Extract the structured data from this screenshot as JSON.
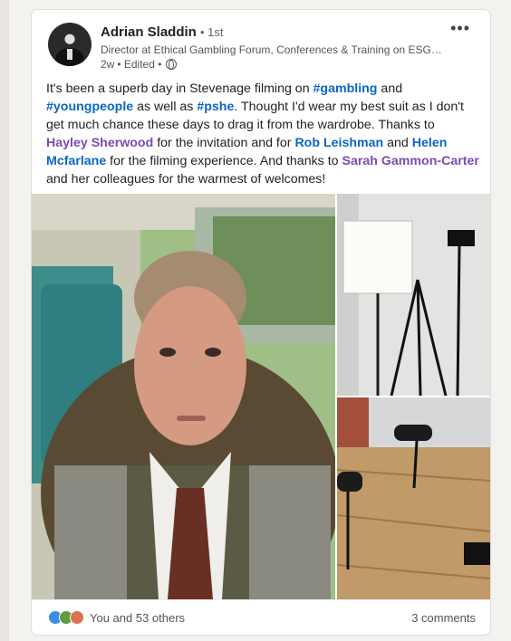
{
  "post": {
    "author_name": "Adrian Sladdin",
    "connection_degree": "• 1st",
    "headline": "Director at Ethical Gambling Forum, Conferences & Training on ESG, ...",
    "time": "2w",
    "edited": "• Edited •",
    "more_label": "•••",
    "text": {
      "p1": "It's been a superb day in Stevenage filming on ",
      "tag1": "#gambling",
      "p2": " and ",
      "tag2": "#youngpeople",
      "p3": " as well as ",
      "tag3": "#pshe",
      "p4": ". Thought I'd wear my best suit as I don't get much chance these days to drag it from the wardrobe. Thanks to ",
      "m1": "Hayley Sherwood",
      "p5": " for the invitation and for ",
      "m2": "Rob Leishman",
      "p6": " and ",
      "m3": "Helen Mcfarlane",
      "p7": " for the filming experience. And thanks to ",
      "m4": "Sarah Gammon-Carter",
      "p8": " and her colleagues for the warmest of welcomes!"
    }
  },
  "social": {
    "reactions_text": "You and 53 others",
    "comments_text": "3 comments"
  },
  "colors": {
    "hashtag": "#0a66c2",
    "mention": "#7a4bb0",
    "like": "#378fe9",
    "celebrate": "#5f9b41",
    "love": "#df704d"
  }
}
